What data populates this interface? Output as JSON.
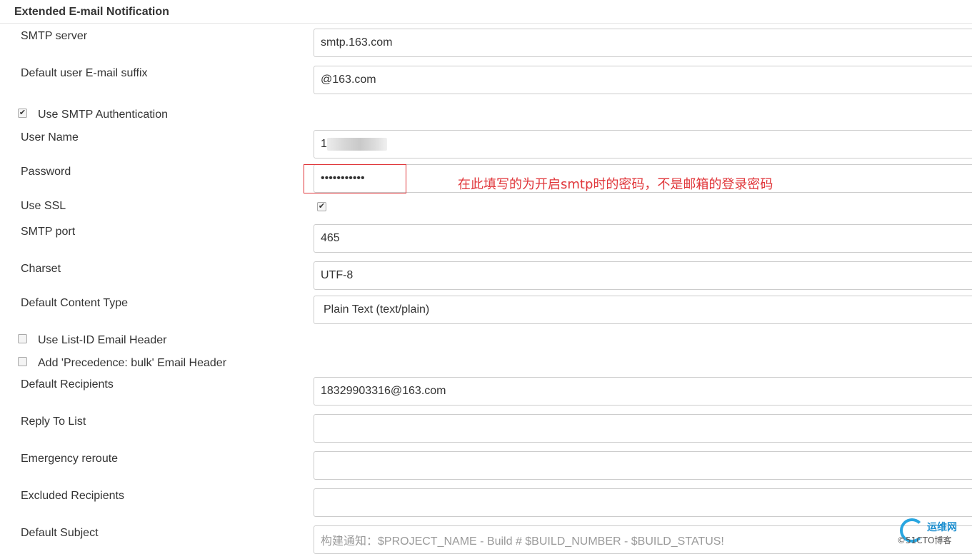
{
  "section": {
    "title": "Extended E-mail Notification"
  },
  "fields": {
    "smtp_server": {
      "label": "SMTP server",
      "value": "smtp.163.com"
    },
    "email_suffix": {
      "label": "Default user E-mail suffix",
      "value": "@163.com"
    },
    "use_smtp_auth": {
      "label": "Use SMTP Authentication",
      "checked": true
    },
    "user_name": {
      "label": "User Name",
      "value": "1"
    },
    "password": {
      "label": "Password",
      "value": "•••••••••••"
    },
    "use_ssl": {
      "label": "Use SSL",
      "checked": true
    },
    "smtp_port": {
      "label": "SMTP port",
      "value": "465"
    },
    "charset": {
      "label": "Charset",
      "value": "UTF-8"
    },
    "content_type": {
      "label": "Default Content Type",
      "value": "Plain Text (text/plain)"
    },
    "list_id_header": {
      "label": "Use List-ID Email Header",
      "checked": false
    },
    "precedence_header": {
      "label": "Add 'Precedence: bulk' Email Header",
      "checked": false
    },
    "default_recipients": {
      "label": "Default Recipients",
      "value": "18329903316@163.com"
    },
    "reply_to": {
      "label": "Reply To List",
      "value": ""
    },
    "emergency_reroute": {
      "label": "Emergency reroute",
      "value": ""
    },
    "excluded_recipients": {
      "label": "Excluded Recipients",
      "value": ""
    },
    "default_subject": {
      "label": "Default Subject",
      "value": "构建通知：$PROJECT_NAME - Build # $BUILD_NUMBER - $BUILD_STATUS!"
    }
  },
  "annotation": {
    "text": "在此填写的为开启smtp时的密码，不是邮箱的登录密码",
    "color": "#e0363a"
  },
  "watermark": {
    "brand": "运维网",
    "sub": "©51CTO博客"
  },
  "icons": {
    "checkbox_checked": "check-mark",
    "watermark_logo": "ring-logo"
  }
}
